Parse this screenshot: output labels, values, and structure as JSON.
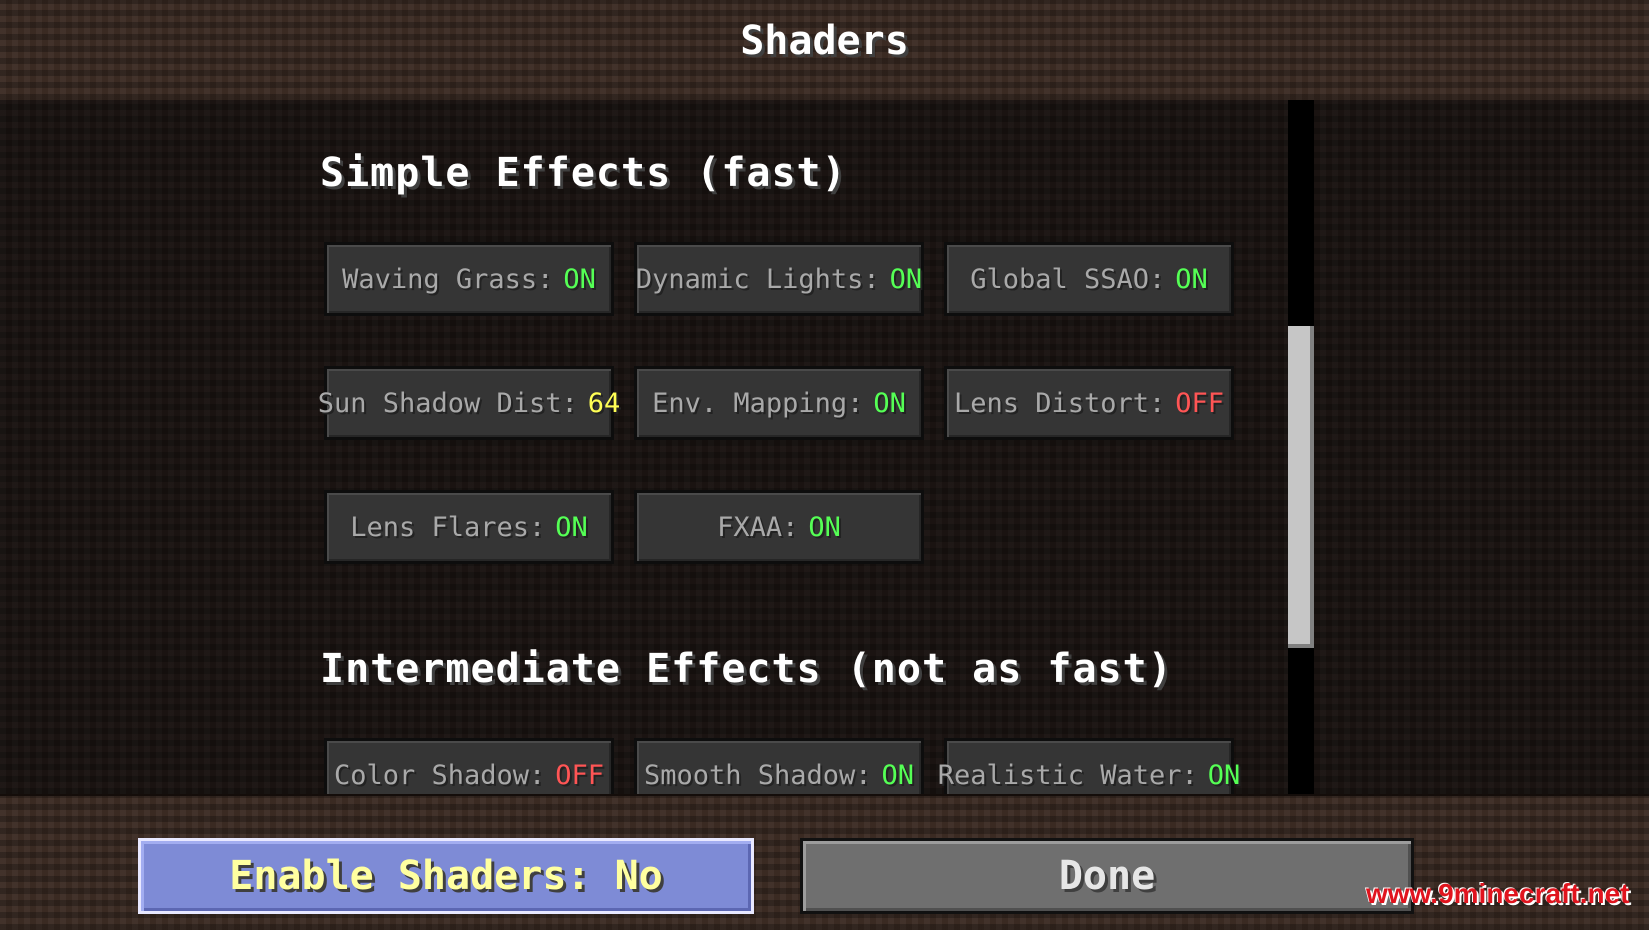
{
  "screen": {
    "title": "Shaders"
  },
  "colors": {
    "on": "#55ff55",
    "off": "#ff5555",
    "number": "#ffff55"
  },
  "sections": [
    {
      "heading": "Simple Effects (fast)",
      "options": [
        {
          "label": "Waving Grass:",
          "value": "ON",
          "state": "on"
        },
        {
          "label": "Dynamic Lights:",
          "value": "ON",
          "state": "on"
        },
        {
          "label": "Global SSAO:",
          "value": "ON",
          "state": "on"
        },
        {
          "label": "Sun Shadow Dist:",
          "value": "64",
          "state": "number"
        },
        {
          "label": "Env. Mapping:",
          "value": "ON",
          "state": "on"
        },
        {
          "label": "Lens Distort:",
          "value": "OFF",
          "state": "off"
        },
        {
          "label": "Lens Flares:",
          "value": "ON",
          "state": "on"
        },
        {
          "label": "FXAA:",
          "value": "ON",
          "state": "on"
        }
      ]
    },
    {
      "heading": "Intermediate Effects (not as fast)",
      "options": [
        {
          "label": "Color Shadow:",
          "value": "OFF",
          "state": "off"
        },
        {
          "label": "Smooth Shadow:",
          "value": "ON",
          "state": "on"
        },
        {
          "label": "Realistic Water:",
          "value": "ON",
          "state": "on"
        }
      ]
    }
  ],
  "footer": {
    "enable_label": "Enable Shaders: No",
    "done_label": "Done"
  },
  "watermark": "www.9minecraft.net"
}
